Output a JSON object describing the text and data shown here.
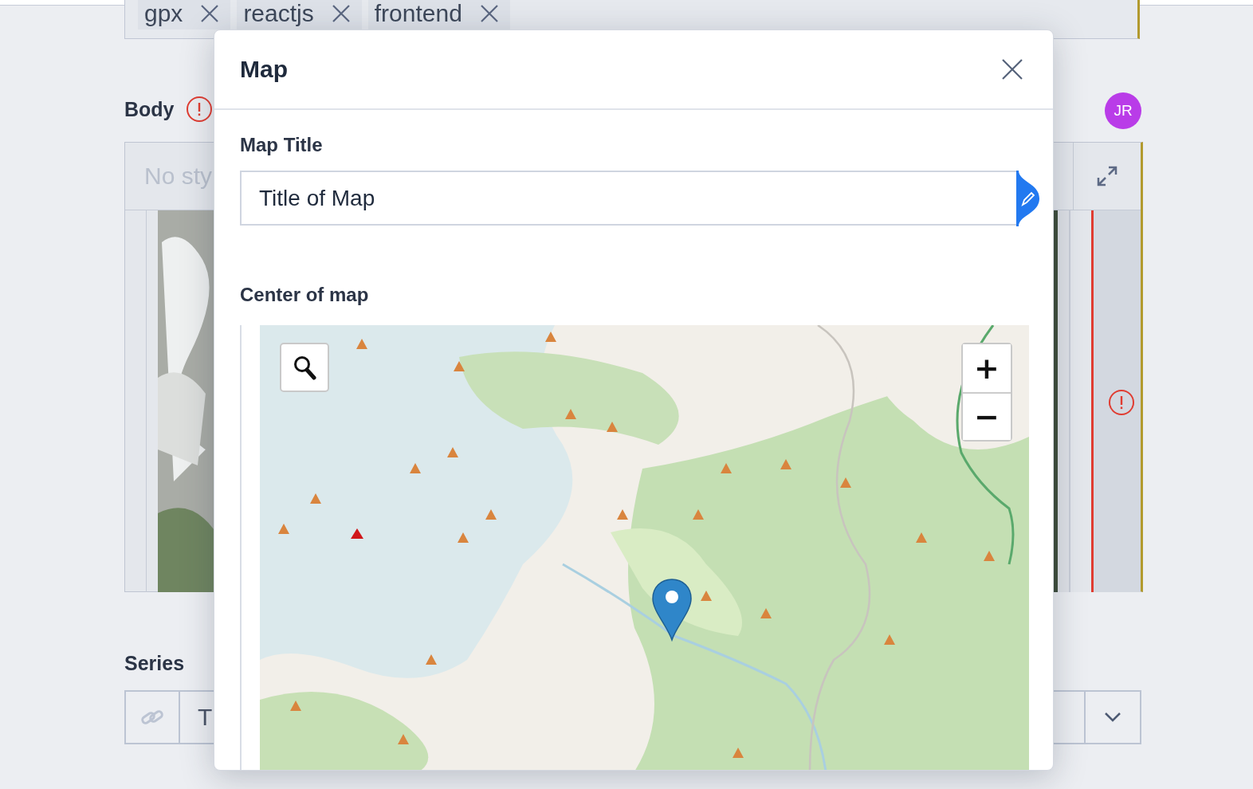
{
  "tags": [
    {
      "label": "gpx"
    },
    {
      "label": "reactjs"
    },
    {
      "label": "frontend"
    }
  ],
  "body": {
    "label": "Body",
    "placeholder": "No sty",
    "avatar": "JR"
  },
  "series": {
    "label": "Series",
    "placeholder": "T"
  },
  "modal": {
    "title": "Map",
    "title_field": {
      "label": "Map Title",
      "value": "Title of Map"
    },
    "map": {
      "label": "Center of map",
      "zoom_in": "+",
      "zoom_out": "−"
    }
  }
}
